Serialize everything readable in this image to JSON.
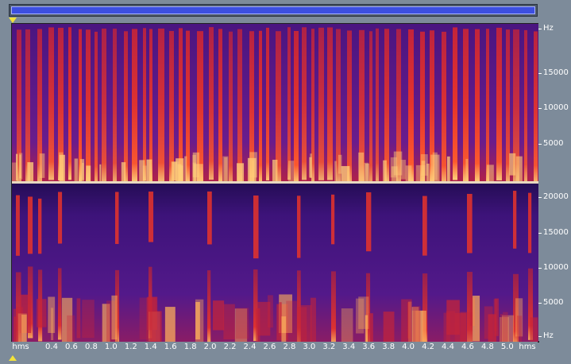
{
  "freq_axis": {
    "unit": "Hz",
    "top_ticks": [
      "15000",
      "10000",
      "5000"
    ],
    "bottom_ticks": [
      "20000",
      "15000",
      "10000",
      "5000"
    ]
  },
  "time_axis": {
    "unit": "hms",
    "labels": [
      "0.4",
      "0.6",
      "0.8",
      "1.0",
      "1.2",
      "1.4",
      "1.6",
      "1.8",
      "2.0",
      "2.2",
      "2.4",
      "2.6",
      "2.8",
      "3.0",
      "3.2",
      "3.4",
      "3.6",
      "3.8",
      "4.0",
      "4.2",
      "4.4",
      "4.6",
      "4.8",
      "5.0"
    ]
  },
  "colors": {
    "background": "#1a0b44",
    "mid": "#6a1c8c",
    "hot": "#e8342a",
    "peak": "#ffd27a",
    "scroll_thumb": "#3c4fe0"
  }
}
